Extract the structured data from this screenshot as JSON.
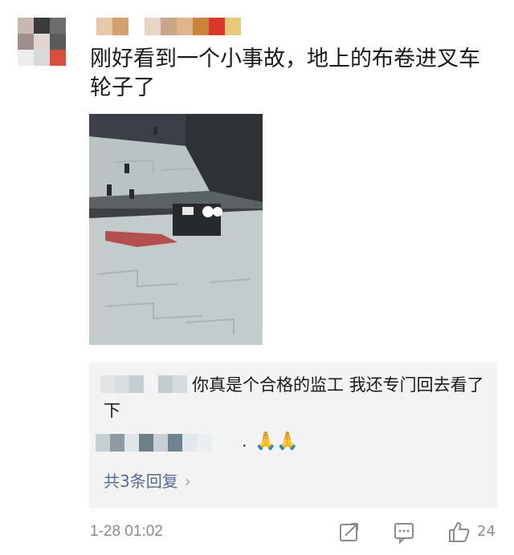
{
  "post": {
    "text": "刚好看到一个小事故，地上的布卷进叉车轮子了",
    "timestamp": "1-28 01:02",
    "like_count": "24"
  },
  "comment": {
    "first_text": "你真是个合格的监工 我还专门回去看了下",
    "second_dot": ".",
    "second_emoji": "🙏🙏",
    "more_replies": "共3条回复",
    "chevron": "›"
  },
  "icons": {
    "avatar": "blurred-avatar",
    "share": "share-icon",
    "comment": "comment-icon",
    "like": "thumbs-up-icon"
  },
  "colors": {
    "link": "#576b95",
    "muted": "#8a8a8a",
    "comment_bg": "#f3f3f3"
  }
}
